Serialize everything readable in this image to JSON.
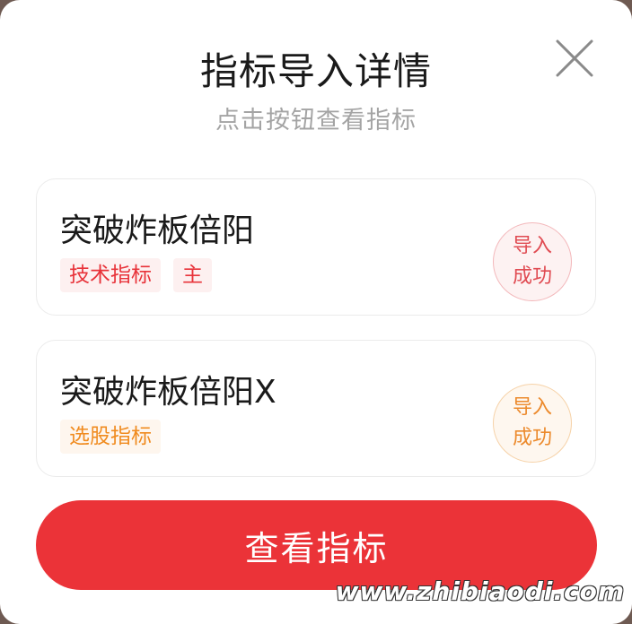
{
  "dialog": {
    "title": "指标导入详情",
    "subtitle": "点击按钮查看指标",
    "close_icon": "close-icon",
    "action_button": "查看指标"
  },
  "indicators": [
    {
      "name": "突破炸板倍阳",
      "tags": [
        "技术指标",
        "主"
      ],
      "tag_color": "#e8333a",
      "status_line1": "导入",
      "status_line2": "成功",
      "status_color": "#e04b52"
    },
    {
      "name": "突破炸板倍阳X",
      "tags": [
        "选股指标"
      ],
      "tag_color": "#f08b1f",
      "status_line1": "导入",
      "status_line2": "成功",
      "status_color": "#ec8a2c"
    }
  ],
  "watermark": "www.zhibiaodi.com",
  "colors": {
    "primary": "#eb3338",
    "accent_orange": "#f08b1f"
  }
}
